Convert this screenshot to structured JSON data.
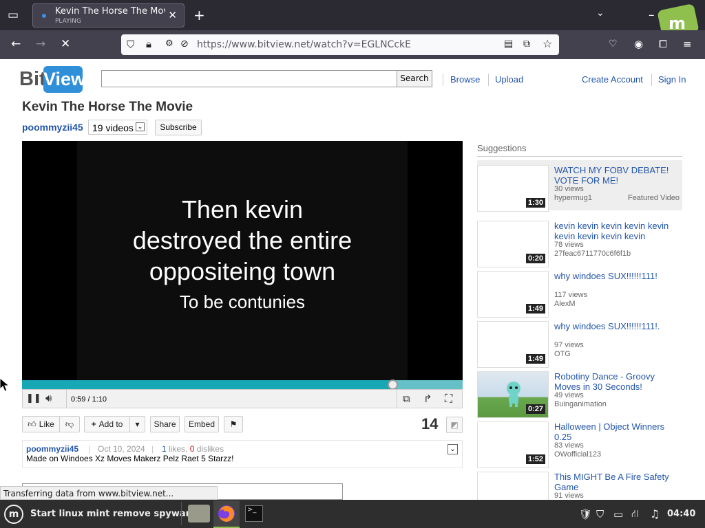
{
  "browser": {
    "tab_title": "Kevin The Horse The Movie",
    "tab_status": "PLAYING",
    "url": "https://www.bitview.net/watch?v=EGLNCckE"
  },
  "site": {
    "logo_left": "Bit",
    "logo_right": "View",
    "search_placeholder": "",
    "search_button": "Search",
    "nav": [
      "Browse",
      "Upload"
    ],
    "account": [
      "Create Account",
      "Sign In"
    ]
  },
  "video": {
    "title": "Kevin The Horse The Movie",
    "uploader": "poommyzii45",
    "video_count": "19 videos",
    "subscribe": "Subscribe",
    "caption_lines": [
      "Then kevin",
      "destroyed the entire",
      "oppositeing town"
    ],
    "caption_sub": "To be contunies",
    "time": "0:59 / 1:10",
    "progress": 0.84,
    "like": "Like",
    "add_to": "Add to",
    "share": "Share",
    "embed": "Embed",
    "views": "14",
    "date": "Oct 10, 2024",
    "likes_num": "1",
    "likes_word": "likes,",
    "dislikes_num": "0",
    "dislikes_word": "dislikes",
    "description": "Made on Windoes Xz Moves Makerz Pelz Raet 5 Starzz!"
  },
  "suggestions": {
    "heading": "Suggestions",
    "items": [
      {
        "title": "WATCH MY FOBV DEBATE! VOTE FOR ME!",
        "views": "30 views",
        "author": "hypermug1",
        "duration": "1:30",
        "featured": "Featured Video"
      },
      {
        "title": "kevin kevin kevin kevin kevin kevin kevin kevin kevin",
        "views": "78 views",
        "author": "27feac6711770c6f6f1b",
        "duration": "0:20"
      },
      {
        "title": "why windoes SUX!!!!!!111!",
        "views": "117 views",
        "author": "AlexM",
        "duration": "1:49"
      },
      {
        "title": "why windoes SUX!!!!!!111!.",
        "views": "97 views",
        "author": "OTG",
        "duration": "1:49"
      },
      {
        "title": "Robotiny Dance - Groovy Moves in 30 Seconds!",
        "views": "49 views",
        "author": "Buinganimation",
        "duration": "0:27"
      },
      {
        "title": "Halloween | Object Winners 0.25",
        "views": "83 views",
        "author": "OWofficial123",
        "duration": "1:52"
      },
      {
        "title": "This MIGHT Be A Fire Safety Game",
        "views": "91 views",
        "author": "",
        "duration": ""
      }
    ]
  },
  "status_bar": "Transferring data from www.bitview.net...",
  "taskbar": {
    "start": "Start linux mint remove spyware",
    "clock": "04:40"
  }
}
